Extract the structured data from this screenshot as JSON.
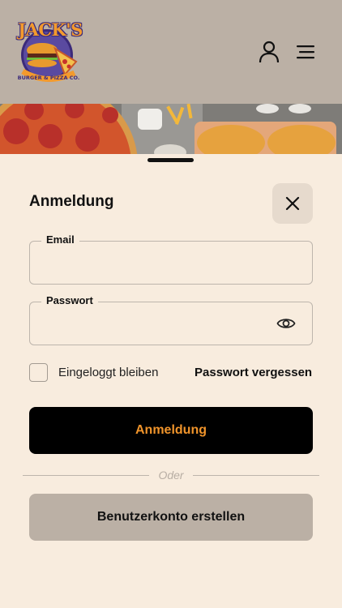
{
  "header": {
    "logo_text": "JACK'S",
    "logo_subtext": "BURGER & PIZZA CO."
  },
  "icons": {
    "user": "user-icon",
    "menu": "menu-icon",
    "close": "close-icon",
    "eye": "eye-icon"
  },
  "login": {
    "title": "Anmeldung",
    "email_label": "Email",
    "email_value": "",
    "password_label": "Passwort",
    "password_value": "",
    "remember_label": "Eingeloggt bleiben",
    "remember_checked": false,
    "forgot_label": "Passwort vergessen",
    "submit_label": "Anmeldung",
    "divider_text": "Oder",
    "create_label": "Benutzerkonto erstellen"
  },
  "colors": {
    "background": "#f8ecde",
    "header": "#bbb0a5",
    "accent": "#f0942b",
    "primary_button": "#000000",
    "secondary_button": "#bbb0a5"
  }
}
